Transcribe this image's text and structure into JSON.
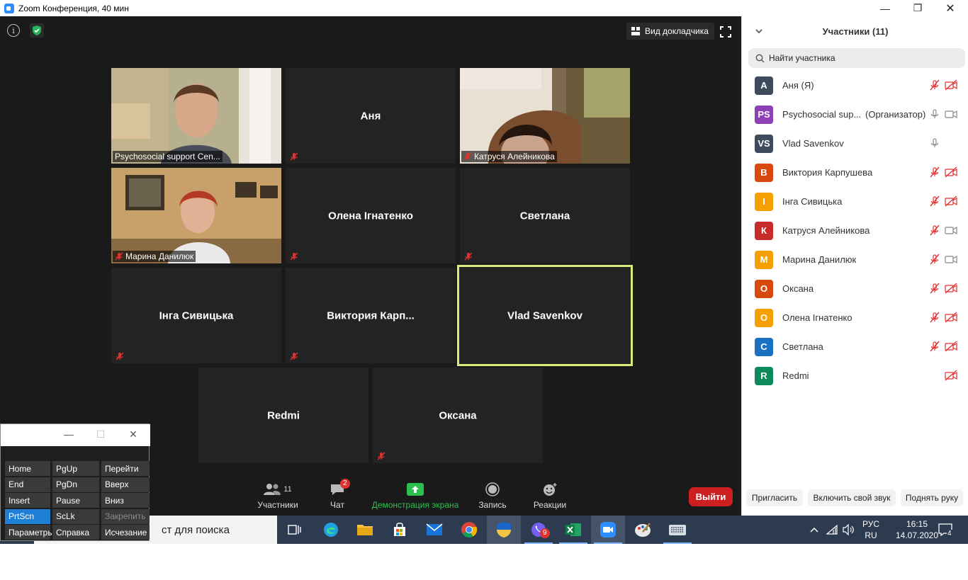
{
  "window": {
    "title": "Zoom Конференция, 40 мин",
    "minimize": "—",
    "maximize": "❐",
    "close": "✕"
  },
  "meeting": {
    "info_icon_text": "i",
    "speaker_view_label": "Вид докладчика",
    "tiles": [
      {
        "name": "Psychosocial support Cen...",
        "video": true,
        "muted": false
      },
      {
        "name": "Аня",
        "video": false,
        "muted": true
      },
      {
        "name": "Катруся Алейникова",
        "video": true,
        "muted": true
      },
      {
        "name": "Марина Данилюк",
        "video": true,
        "muted": true
      },
      {
        "name": "Олена Ігнатенко",
        "video": false,
        "muted": true
      },
      {
        "name": "Светлана",
        "video": false,
        "muted": true
      },
      {
        "name": "Інга Сивицька",
        "video": false,
        "muted": true
      },
      {
        "name": "Виктория  Карп...",
        "video": false,
        "muted": true
      },
      {
        "name": "Vlad Savenkov",
        "video": false,
        "muted": false,
        "active_speaker": true
      },
      {
        "name": "Redmi",
        "video": false,
        "muted": false
      },
      {
        "name": "Оксана",
        "video": false,
        "muted": true
      }
    ],
    "toolbar": {
      "participants_count": "11",
      "participants_label": "Участники",
      "chat_label": "Чат",
      "chat_badge": "2",
      "share_label": "Демонстрация экрана",
      "record_label": "Запись",
      "reactions_label": "Реакции",
      "leave_label": "Выйти"
    },
    "colors": {
      "share_green": "#2dbf4e",
      "active_border": "#d7ec7a",
      "leave_red": "#cc1f1f"
    }
  },
  "panel": {
    "title": "Участники (11)",
    "search_placeholder": "Найти участника",
    "participants": [
      {
        "initials": "А",
        "name": "Аня (Я)",
        "role": "",
        "color": "#3d4b5c",
        "mic": "muted",
        "cam": "off"
      },
      {
        "initials": "PS",
        "name": "Psychosocial sup...",
        "role": "(Организатор)",
        "color": "#8d3fb5",
        "mic": "on",
        "cam": "on"
      },
      {
        "initials": "VS",
        "name": "Vlad Savenkov",
        "role": "",
        "color": "#3d4b5c",
        "mic": "on",
        "cam": "none"
      },
      {
        "initials": "В",
        "name": "Виктория Карпушева",
        "role": "",
        "color": "#d9480f",
        "mic": "muted",
        "cam": "off"
      },
      {
        "initials": "І",
        "name": "Інга Сивицька",
        "role": "",
        "color": "#f59f00",
        "mic": "muted",
        "cam": "off"
      },
      {
        "initials": "К",
        "name": "Катруся Алейникова",
        "role": "",
        "color": "#c92a2a",
        "mic": "muted",
        "cam": "on"
      },
      {
        "initials": "М",
        "name": "Марина Данилюк",
        "role": "",
        "color": "#f59f00",
        "mic": "muted",
        "cam": "on"
      },
      {
        "initials": "О",
        "name": "Оксана",
        "role": "",
        "color": "#d9480f",
        "mic": "muted",
        "cam": "off"
      },
      {
        "initials": "О",
        "name": "Олена Ігнатенко",
        "role": "",
        "color": "#f59f00",
        "mic": "muted",
        "cam": "off"
      },
      {
        "initials": "С",
        "name": "Светлана",
        "role": "",
        "color": "#1971c2",
        "mic": "muted",
        "cam": "off"
      },
      {
        "initials": "R",
        "name": "Redmi",
        "role": "",
        "color": "#0c8a5a",
        "mic": "none",
        "cam": "off"
      }
    ],
    "invite_label": "Пригласить",
    "unmute_label": "Включить свой звук",
    "raise_hand_label": "Поднять руку"
  },
  "taskbar": {
    "search_text": "ст для поиска",
    "viber_badge": "9",
    "lang_top": "РУС",
    "lang_bottom": "RU",
    "time": "16:15",
    "date": "14.07.2020",
    "notif_count": "4"
  },
  "osk": {
    "keys": [
      {
        "label": "Home",
        "col": 0,
        "row": 0
      },
      {
        "label": "PgUp",
        "col": 1,
        "row": 0
      },
      {
        "label": "Перейти",
        "col": 2,
        "row": 0
      },
      {
        "label": "End",
        "col": 0,
        "row": 1
      },
      {
        "label": "PgDn",
        "col": 1,
        "row": 1
      },
      {
        "label": "Вверх",
        "col": 2,
        "row": 1
      },
      {
        "label": "Insert",
        "col": 0,
        "row": 2
      },
      {
        "label": "Pause",
        "col": 1,
        "row": 2
      },
      {
        "label": "Вниз",
        "col": 2,
        "row": 2
      },
      {
        "label": "PrtScn",
        "col": 0,
        "row": 3,
        "highlight": true
      },
      {
        "label": "ScLk",
        "col": 1,
        "row": 3
      },
      {
        "label": "Закрепить",
        "col": 2,
        "row": 3,
        "dim": true
      },
      {
        "label": "Параметры",
        "col": 0,
        "row": 4
      },
      {
        "label": "Справка",
        "col": 1,
        "row": 4
      },
      {
        "label": "Исчезание",
        "col": 2,
        "row": 4
      }
    ]
  }
}
